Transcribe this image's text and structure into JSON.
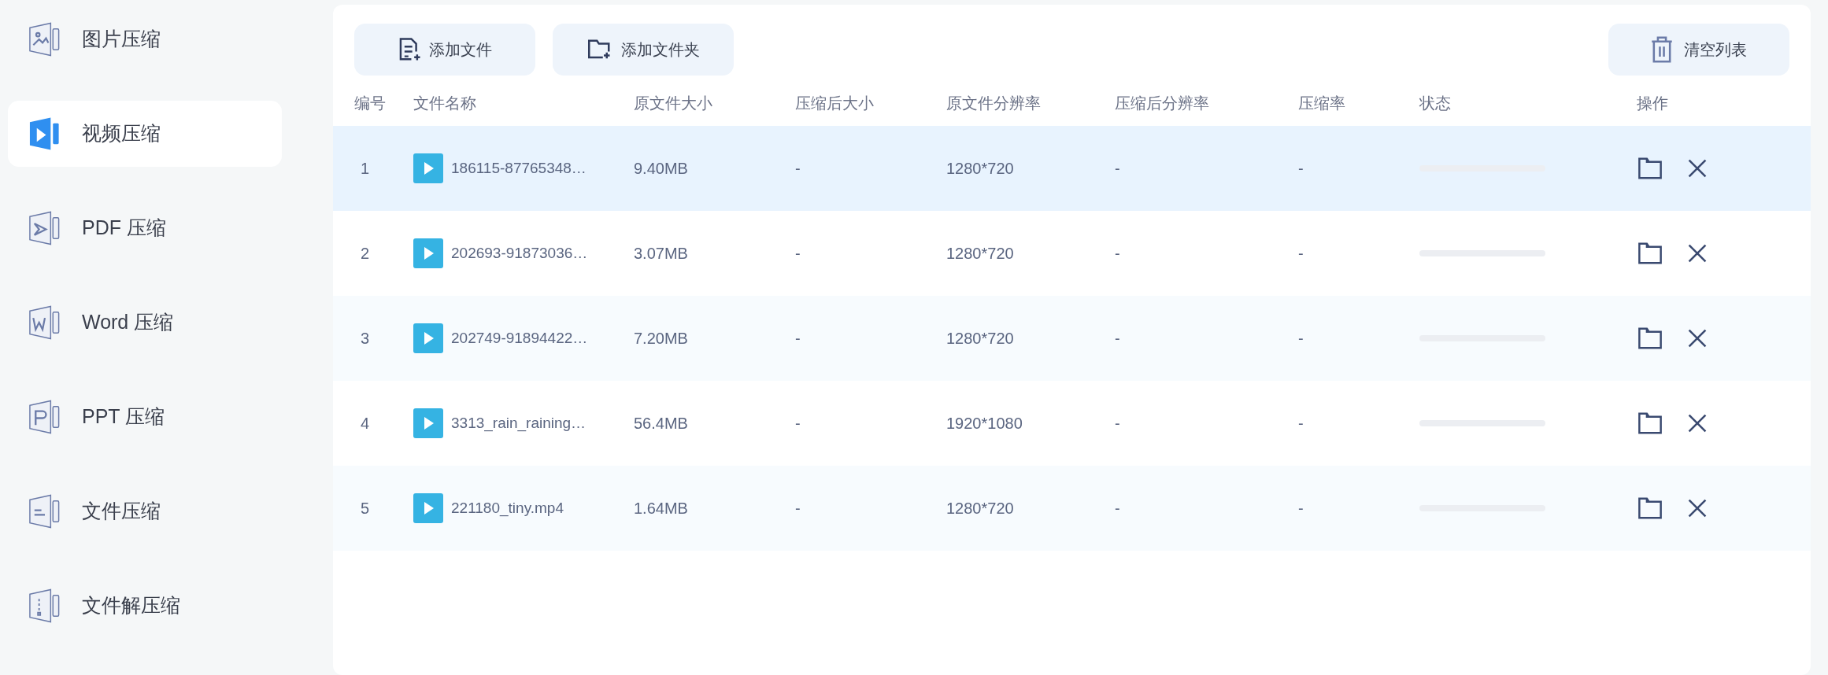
{
  "sidebar": {
    "items": [
      {
        "label": "图片压缩",
        "selected": false
      },
      {
        "label": "视频压缩",
        "selected": true
      },
      {
        "label": "PDF 压缩",
        "selected": false
      },
      {
        "label": "Word 压缩",
        "selected": false
      },
      {
        "label": "PPT 压缩",
        "selected": false
      },
      {
        "label": "文件压缩",
        "selected": false
      },
      {
        "label": "文件解压缩",
        "selected": false
      }
    ]
  },
  "toolbar": {
    "add_file": "添加文件",
    "add_folder": "添加文件夹",
    "clear_list": "清空列表"
  },
  "table": {
    "columns": [
      "编号",
      "文件名称",
      "原文件大小",
      "压缩后大小",
      "原文件分辨率",
      "压缩后分辨率",
      "压缩率",
      "状态",
      "操作"
    ],
    "rows": [
      {
        "index": "1",
        "name": "186115-87765348…",
        "size": "9.40MB",
        "compressed_size": "-",
        "resolution": "1280*720",
        "compressed_resolution": "-",
        "rate": "-",
        "selected": true
      },
      {
        "index": "2",
        "name": "202693-91873036…",
        "size": "3.07MB",
        "compressed_size": "-",
        "resolution": "1280*720",
        "compressed_resolution": "-",
        "rate": "-",
        "selected": false
      },
      {
        "index": "3",
        "name": "202749-91894422…",
        "size": "7.20MB",
        "compressed_size": "-",
        "resolution": "1280*720",
        "compressed_resolution": "-",
        "rate": "-",
        "selected": false
      },
      {
        "index": "4",
        "name": "3313_rain_raining…",
        "size": "56.4MB",
        "compressed_size": "-",
        "resolution": "1920*1080",
        "compressed_resolution": "-",
        "rate": "-",
        "selected": false
      },
      {
        "index": "5",
        "name": "221180_tiny.mp4",
        "size": "1.64MB",
        "compressed_size": "-",
        "resolution": "1280*720",
        "compressed_resolution": "-",
        "rate": "-",
        "selected": false
      }
    ]
  }
}
